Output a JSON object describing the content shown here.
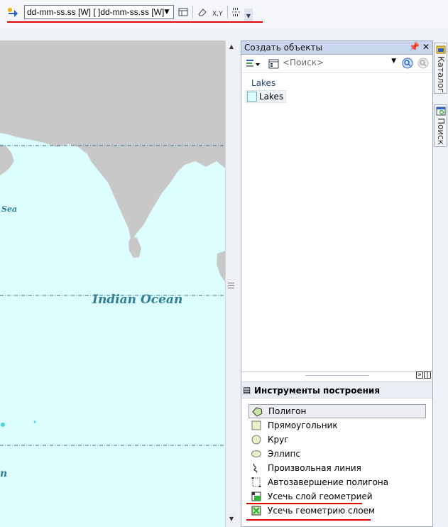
{
  "toolbar": {
    "coord_format_value": "dd-mm-ss.ss [W] [ ]dd-mm-ss.ss [W]"
  },
  "map": {
    "labels": {
      "sea": "Sea",
      "ocean": "Indian Ocean",
      "partial": "n"
    },
    "colors": {
      "water": "#dcfffe",
      "land": "#c8c8c8",
      "grid": "#3a6f8f"
    }
  },
  "create_features": {
    "title": "Создать объекты",
    "search_placeholder": "<Поиск>",
    "group_name": "Lakes",
    "templates": [
      {
        "label": "Lakes"
      }
    ]
  },
  "construction_tools": {
    "title": "Инструменты построения",
    "items": [
      {
        "label": "Полигон",
        "icon": "polygon-icon"
      },
      {
        "label": "Прямоугольник",
        "icon": "rectangle-icon"
      },
      {
        "label": "Круг",
        "icon": "circle-icon"
      },
      {
        "label": "Эллипс",
        "icon": "ellipse-icon"
      },
      {
        "label": "Произвольная линия",
        "icon": "freehand-icon"
      },
      {
        "label": "Автозавершение полигона",
        "icon": "auto-complete-polygon-icon"
      },
      {
        "label": "Усечь слой геометрией",
        "icon": "clip-layer-icon"
      },
      {
        "label": "Усечь геометрию слоем",
        "icon": "clip-geometry-icon"
      }
    ]
  },
  "side_tabs": {
    "catalog": "Каталог",
    "search": "Поиск"
  },
  "colors": {
    "accent_red": "#e00000",
    "panel_title_bg": "#c9d7ec"
  }
}
